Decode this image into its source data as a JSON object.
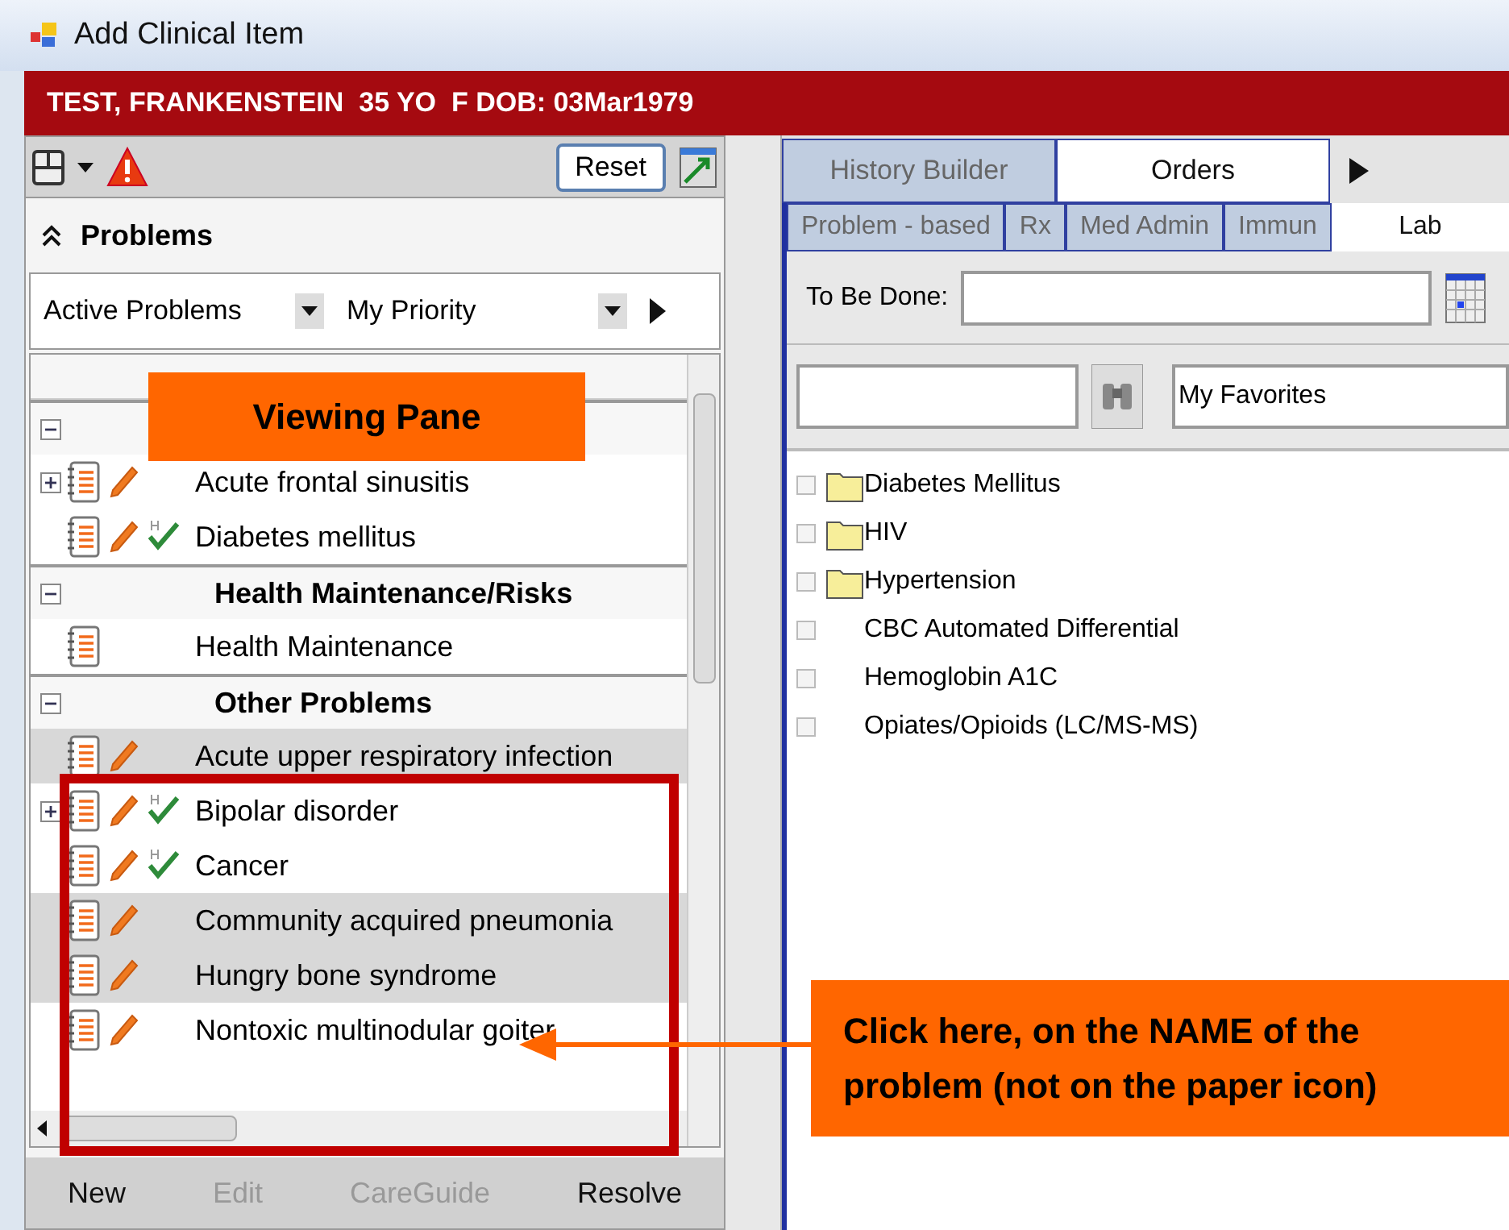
{
  "window": {
    "title": "Add Clinical Item"
  },
  "patient_banner": "TEST, FRANKENSTEIN  35 YO  F DOB: 03Mar1979",
  "left_toolbar": {
    "reset_button": "Reset"
  },
  "problems": {
    "title": "Problems",
    "filters": [
      {
        "value": "Active Problems"
      },
      {
        "value": "My Priority"
      }
    ],
    "groups": [
      {
        "items": [
          {
            "name": "Acute frontal sinusitis",
            "expandable": true,
            "edit": true,
            "check_icon": false,
            "selected": false
          },
          {
            "name": "Diabetes mellitus",
            "expandable": false,
            "edit": true,
            "check_icon": true,
            "selected": false
          }
        ]
      },
      {
        "label": "Health Maintenance/Risks",
        "items": [
          {
            "name": "Health Maintenance",
            "expandable": false,
            "edit": false,
            "check_icon": false,
            "selected": false
          }
        ]
      },
      {
        "label": "Other Problems",
        "items": [
          {
            "name": "Acute upper respiratory infection",
            "expandable": false,
            "edit": true,
            "check_icon": false,
            "selected": true
          },
          {
            "name": "Bipolar disorder",
            "expandable": true,
            "edit": true,
            "check_icon": true,
            "selected": false
          },
          {
            "name": "Cancer",
            "expandable": false,
            "edit": true,
            "check_icon": true,
            "selected": false
          },
          {
            "name": "Community acquired pneumonia",
            "expandable": false,
            "edit": true,
            "check_icon": false,
            "selected": true
          },
          {
            "name": "Hungry bone syndrome",
            "expandable": false,
            "edit": true,
            "check_icon": false,
            "selected": true
          },
          {
            "name": "Nontoxic multinodular goiter",
            "expandable": false,
            "edit": true,
            "check_icon": false,
            "selected": false
          }
        ]
      }
    ],
    "buttons": [
      {
        "label": "New",
        "disabled": false
      },
      {
        "label": "Edit",
        "disabled": true
      },
      {
        "label": "CareGuide",
        "disabled": true
      },
      {
        "label": "Resolve",
        "disabled": false
      }
    ]
  },
  "tabs": [
    {
      "label": "History Builder",
      "selected": false
    },
    {
      "label": "Orders",
      "selected": true
    }
  ],
  "subtabs": [
    {
      "label": "Problem - based",
      "selected": false
    },
    {
      "label": "Rx",
      "selected": false
    },
    {
      "label": "Med Admin",
      "selected": false
    },
    {
      "label": "Immun",
      "selected": false
    },
    {
      "label": "Lab",
      "selected": true
    }
  ],
  "to_be_done": {
    "label": "To Be Done:"
  },
  "favorites": {
    "value": "My Favorites"
  },
  "order_items": [
    {
      "name": "Diabetes Mellitus",
      "kind": "folder",
      "checked": false
    },
    {
      "name": "HIV",
      "kind": "folder",
      "checked": false
    },
    {
      "name": "Hypertension",
      "kind": "folder",
      "checked": false
    },
    {
      "name": "CBC Automated Differential",
      "kind": "item",
      "checked": false
    },
    {
      "name": "Hemoglobin A1C",
      "kind": "item",
      "checked": false
    },
    {
      "name": "Opiates/Opioids (LC/MS-MS)",
      "kind": "item",
      "checked": false
    }
  ],
  "annotations": [
    {
      "kind": "label",
      "text": "Viewing Pane"
    },
    {
      "kind": "callout",
      "text": "Click here, on the NAME of the problem (not on the paper icon)"
    }
  ]
}
